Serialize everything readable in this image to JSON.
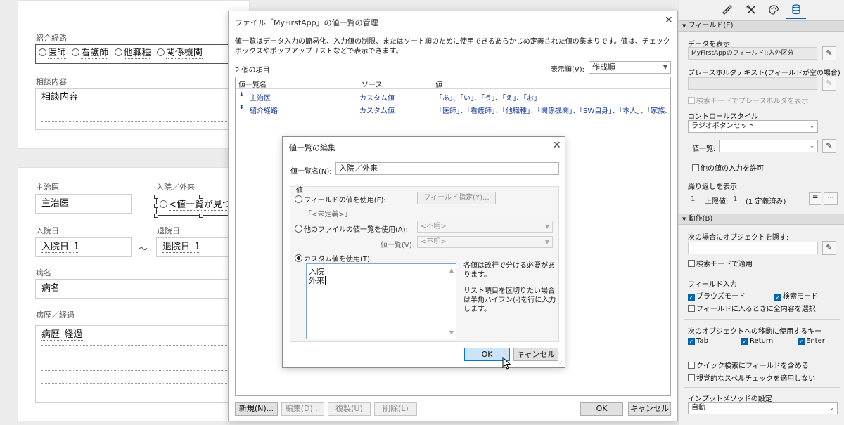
{
  "layout": {
    "introduction": {
      "label": "紹介経路",
      "options": [
        "医師",
        "看護師",
        "他職種",
        "関係機関"
      ]
    },
    "consult": {
      "label": "相談内容",
      "value": "相談内容"
    },
    "doctor": {
      "label": "主治医",
      "value": "主治医"
    },
    "inout": {
      "label": "入院／外来",
      "value": "<値一覧が見つ"
    },
    "admit": {
      "label": "入院日",
      "value": "入院日_1"
    },
    "tilde": "～",
    "discharge": {
      "label": "退院日",
      "value": "退院日_1"
    },
    "disease": {
      "label": "病名",
      "value": "病名"
    },
    "history": {
      "label": "病歴／経過",
      "value": "病歴_経過"
    }
  },
  "manage_dialog": {
    "title": "ファイル「MyFirstApp」の値一覧の管理",
    "description": "値一覧はデータ入力の簡易化、入力値の制限、またはソート順のために使用できるあらかじめ定義された値の集まりです。値は、チェックボックスやポップアップリストなどで表示できます。",
    "count": "2 個の項目",
    "sort_label": "表示順(V):",
    "sort_value": "作成順",
    "columns": [
      "値一覧名",
      "ソース",
      "値"
    ],
    "rows": [
      {
        "name": "主治医",
        "source": "カスタム値",
        "values": "「あ」、「い」、「う」、「え」、「お」"
      },
      {
        "name": "紹介経路",
        "source": "カスタム値",
        "values": "「医師」、「看護師」、「他職種」、「関係機関」、「SW自身」、「本人」、「家族..."
      }
    ],
    "buttons": {
      "new": "新規(N)...",
      "edit": "編集(D)...",
      "duplicate": "複製(U)",
      "delete": "削除(L)",
      "ok": "OK",
      "cancel": "キャンセル"
    }
  },
  "edit_dialog": {
    "title": "値一覧の編集",
    "name_label": "値一覧名(N):",
    "name_value": "入院／外来",
    "group_label": "値",
    "option_field": "フィールドの値を使用(F):",
    "field_button": "フィールド指定(Y)...",
    "undefined": "「<未定義>」",
    "option_other": "他のファイルの値一覧を使用(A):",
    "unknown1": "<不明>",
    "valuelist_label": "値一覧(V):",
    "unknown2": "<不明>",
    "option_custom": "カスタム値を使用(T)",
    "custom_values": [
      "入院",
      "外来"
    ],
    "hint1": "各値は改行で分ける必要があります。",
    "hint2": "リスト項目を区切りたい場合は半角ハイフン(-)を行に入力します。",
    "ok": "OK",
    "cancel": "キャンセル"
  },
  "inspector": {
    "section_field": "フィールド(E)",
    "display_data_label": "データを表示",
    "display_data_value": "MyFirstAppのフィールド::入外区分",
    "placeholder_label": "プレースホルダテキスト(フィールドが空の場合)",
    "search_placeholder": "検索モードでプレースホルダを表示",
    "control_style_label": "コントロールスタイル",
    "control_style_value": "ラジオボタンセット",
    "valuelist_label": "値一覧:",
    "allow_other": "他の値の入力を許可",
    "repeat_label": "繰り返しを表示",
    "repeat_from": "1",
    "repeat_max_label": "上限値:",
    "repeat_max": "1",
    "repeat_defined": "(1 定義済み)",
    "section_behavior": "動作(B)",
    "hide_when_label": "次の場合にオブジェクトを隠す:",
    "apply_search": "検索モードで適用",
    "field_entry_label": "フィールド入力",
    "browse_mode": "ブラウズモード",
    "find_mode": "検索モード",
    "select_all": "フィールドに入るときに全内容を選択",
    "next_object_label": "次のオブジェクトへの移動に使用するキー",
    "key_tab": "Tab",
    "key_return": "Return",
    "key_enter": "Enter",
    "quick_find": "クイック検索にフィールドを含める",
    "spell_check": "視覚的なスペルチェックを適用しない",
    "input_method_label": "インプットメソッドの設定",
    "input_method_value": "自動"
  },
  "icons": [
    "ruler-icon",
    "tools-icon",
    "palette-icon",
    "database-icon",
    "pencil-icon",
    "close-icon",
    "chevron-down-icon",
    "mouse-cursor-icon"
  ],
  "colors": {
    "accent": "#0063b1",
    "primary_button": "#cce4f7",
    "link": "#1a3c9b"
  }
}
